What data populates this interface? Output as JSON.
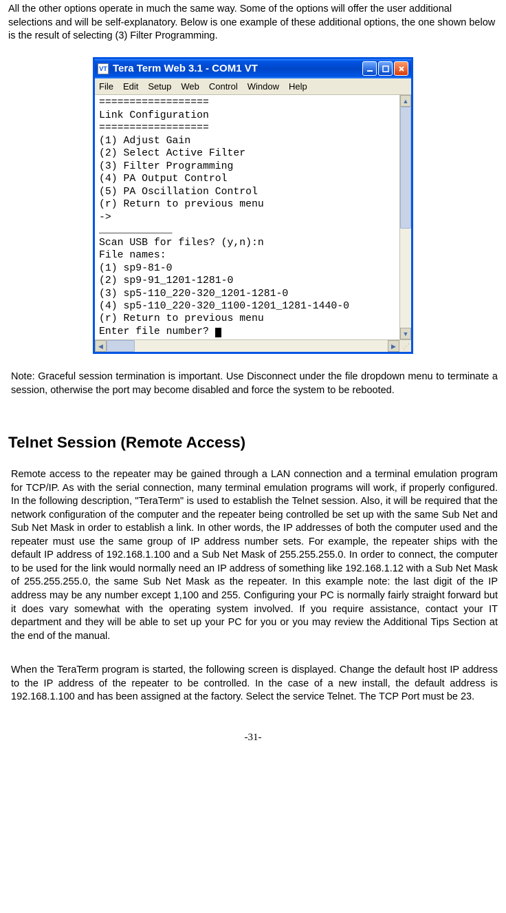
{
  "intro": "All the other options operate in much the same way. Some of the options will offer the user additional selections and will be self-explanatory. Below is one example of these additional options, the one shown below is the result of selecting (3) Filter Programming.",
  "terminal": {
    "title": "Tera Term Web 3.1 - COM1 VT",
    "icon_label": "VT",
    "menu": [
      "File",
      "Edit",
      "Setup",
      "Web",
      "Control",
      "Window",
      "Help"
    ],
    "lines": [
      "==================",
      "Link Configuration",
      "==================",
      "(1) Adjust Gain",
      "(2) Select Active Filter",
      "(3) Filter Programming",
      "(4) PA Output Control",
      "(5) PA Oscillation Control",
      "(r) Return to previous menu",
      "->",
      "____________",
      "Scan USB for files? (y,n):n",
      "File names:",
      "(1) sp9-81-0",
      "(2) sp9-91_1201-1281-0",
      "(3) sp5-110_220-320_1201-1281-0",
      "(4) sp5-110_220-320_1100-1201_1281-1440-0",
      "(r) Return to previous menu",
      "Enter file number? "
    ]
  },
  "note": "Note: Graceful session termination is important. Use Disconnect under the file dropdown menu to terminate a session, otherwise the port may become disabled and force the system to be rebooted.",
  "heading": "Telnet Session (Remote Access)",
  "body1": "Remote access to the repeater may be gained through a LAN connection and a terminal emulation program for TCP/IP. As with the serial connection, many terminal emulation programs will work, if properly configured.  In the following description, \"TeraTerm\" is used to establish the Telnet session. Also, it will be required that the network configuration of the computer and the repeater being controlled be set up with the same Sub Net and Sub Net Mask in order to establish a link. In other words, the IP addresses of both the computer used and the repeater must use the same group of IP address number sets. For example, the repeater ships with the default IP address of 192.168.1.100 and a Sub Net Mask of 255.255.255.0. In order to connect, the computer to be used for the link would normally need an IP address of something like 192.168.1.12 with a Sub Net Mask of 255.255.255.0, the same Sub Net Mask as the repeater. In this example note: the last digit of the IP address may be any number except 1,100 and 255. Configuring your PC is normally fairly straight forward but it does vary somewhat with the operating system involved.  If you require assistance, contact your IT department and they will be able to set up your PC for you or you may review the Additional Tips Section at the end of the manual.",
  "body2": "When the TeraTerm program is started, the following screen is displayed. Change the default host IP address to the IP address of the repeater to be controlled. In the case of a new install, the default address is 192.168.1.100 and has been assigned at the factory. Select the service Telnet. The TCP Port must be 23.",
  "page_number": "-31-"
}
